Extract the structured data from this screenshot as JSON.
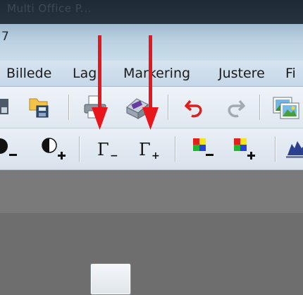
{
  "background_window": {
    "title": "Multi Office P..."
  },
  "window": {
    "number_fragment": "7"
  },
  "menubar": {
    "items": [
      {
        "label": "Billede"
      },
      {
        "label": "Lag"
      },
      {
        "label": "Markering"
      },
      {
        "label": "Justere"
      },
      {
        "label": "Fi"
      }
    ]
  },
  "toolbar_row1": {
    "icons": [
      "save-icon",
      "save-as-icon",
      "print-icon",
      "scan-icon",
      "undo-icon",
      "redo-icon",
      "image-icon"
    ]
  },
  "toolbar_row2": {
    "icons": [
      "brightness-decrease-icon",
      "brightness-increase-icon",
      "gamma-decrease-icon",
      "gamma-increase-icon",
      "color-decrease-icon",
      "color-increase-icon",
      "histogram-icon"
    ],
    "gamma_symbol": "Γ",
    "minus": "−",
    "plus": "+"
  },
  "annotations": {
    "arrow_color": "#e8161b",
    "arrows": [
      "arrow-to-gamma-decrease",
      "arrow-to-gamma-increase"
    ]
  },
  "colors": {
    "menubar": "#c9d9ea",
    "toolbar": "#e4ebf3",
    "workspace": "#7a7a7a"
  }
}
